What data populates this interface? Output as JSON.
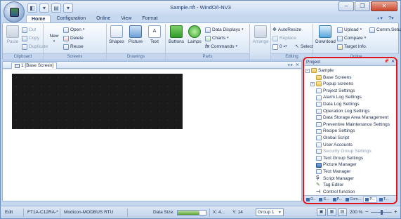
{
  "window": {
    "title": "Sample.nft - WindO/I-NV3",
    "controls": {
      "minimize": "–",
      "maximize": "❐",
      "close": "✕"
    }
  },
  "quick_access": {
    "items": [
      "◧",
      "▾",
      "▤",
      "▾"
    ]
  },
  "ribbon": {
    "tabs": [
      "Home",
      "Configuration",
      "Online",
      "View",
      "Format"
    ],
    "active_tab": "Home",
    "help_icons": [
      "◐▾",
      "?▾"
    ],
    "clipboard": {
      "label": "Clipboard",
      "paste": "Paste",
      "cut": "Cut",
      "copy": "Copy",
      "duplicate": "Duplicate"
    },
    "screens": {
      "label": "Screens",
      "new": "New",
      "open": "Open",
      "delete": "Delete",
      "reuse": "Reuse"
    },
    "drawings": {
      "label": "Drawings",
      "shapes": "Shapes",
      "picture": "Picture",
      "text": "Text"
    },
    "parts": {
      "label": "Parts",
      "buttons": "Buttons",
      "lamps": "Lamps",
      "data_displays": "Data Displays",
      "charts": "Charts",
      "commands": "Commands"
    },
    "arrange": {
      "label": "",
      "arrange": "Arrange"
    },
    "editing": {
      "label": "Editing",
      "autoresize": "AutoResize",
      "replace": "Replace",
      "spin_value": "0",
      "select": "Select"
    },
    "download_group": {
      "label": "Online",
      "download": "Download",
      "upload": "Upload",
      "compare": "Compare",
      "target_info": "Target Info.",
      "comm_setup": "Comm.Setup"
    }
  },
  "document": {
    "tab_label": "1 [Base Screen]",
    "strip_controls": [
      "◂ ▸",
      "✕"
    ]
  },
  "project_panel": {
    "title": "Project",
    "pin": "📌",
    "close": "✕",
    "tree": [
      {
        "label": "Sample",
        "icon": "folder",
        "indent": 0,
        "expander": "−"
      },
      {
        "label": "Base Screens",
        "icon": "folder",
        "indent": 1,
        "expander": ""
      },
      {
        "label": "Popup screens",
        "icon": "folder",
        "indent": 1,
        "expander": "+"
      },
      {
        "label": "Project Settings",
        "icon": "page",
        "indent": 1,
        "expander": ""
      },
      {
        "label": "Alarm Log Settings",
        "icon": "page",
        "indent": 1,
        "expander": ""
      },
      {
        "label": "Data Log Settings",
        "icon": "page",
        "indent": 1,
        "expander": ""
      },
      {
        "label": "Operation Log Settings",
        "icon": "page",
        "indent": 1,
        "expander": ""
      },
      {
        "label": "Data Storage Area Management",
        "icon": "page",
        "indent": 1,
        "expander": ""
      },
      {
        "label": "Preventive Maintenance Settings",
        "icon": "page",
        "indent": 1,
        "expander": ""
      },
      {
        "label": "Recipe Settings",
        "icon": "page",
        "indent": 1,
        "expander": ""
      },
      {
        "label": "Global Script",
        "icon": "page",
        "indent": 1,
        "expander": ""
      },
      {
        "label": "User Accounts",
        "icon": "page",
        "indent": 1,
        "expander": ""
      },
      {
        "label": "Security Group Settings",
        "icon": "page",
        "indent": 1,
        "expander": "",
        "disabled": true
      },
      {
        "label": "Text Group Settings",
        "icon": "page",
        "indent": 1,
        "expander": ""
      },
      {
        "label": "Picture Manager",
        "icon": "pm",
        "indent": 1,
        "expander": ""
      },
      {
        "label": "Text Manager",
        "icon": "page",
        "indent": 1,
        "expander": ""
      },
      {
        "label": "Script Manager",
        "icon": "sm",
        "indent": 1,
        "expander": ""
      },
      {
        "label": "Tag Editor",
        "icon": "tag",
        "indent": 1,
        "expander": ""
      },
      {
        "label": "Control function",
        "icon": "ctrl",
        "indent": 1,
        "expander": ""
      }
    ],
    "bottom_tabs": [
      "O..",
      "S...",
      "P...",
      "Com...",
      "P...",
      "T..."
    ]
  },
  "statusbar": {
    "mode": "Edit",
    "device": "FT1A-C12RA-*",
    "protocol": "Modicon-MODBUS RTU",
    "data_size_label": "Data Size:",
    "data_size_fill_fraction": 0.78,
    "x": "X: 4...",
    "y": "Y: 14",
    "group": "Group 1",
    "zoom": "200 %",
    "zoom_out": "−",
    "zoom_in": "+",
    "zoom_fraction": 0.45
  },
  "colors": {
    "accent": "#4e77b0",
    "highlight_border": "#e0141a",
    "canvas": "#1b1b1b"
  }
}
